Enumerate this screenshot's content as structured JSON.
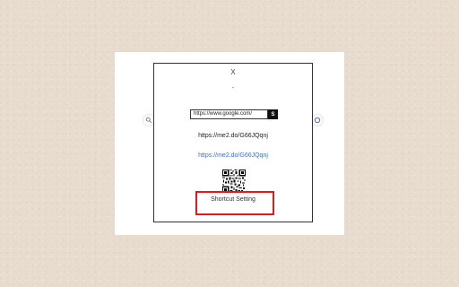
{
  "popup": {
    "close_label": "X",
    "dot_label": "-",
    "url_value": "https://www.google.com/",
    "shorten_button_label": "S",
    "short_url_text": "https://me2.do/G66JQqnj",
    "short_url_link": "https://me2.do/G66JQqnj",
    "shortcut_setting_label": "Shortcut Setting"
  },
  "icons": {
    "left": "search-icon",
    "right": "extension-icon"
  },
  "colors": {
    "background": "#e7dccd",
    "link": "#3b6fd8",
    "highlight": "#e01b1b",
    "button": "#111111"
  }
}
